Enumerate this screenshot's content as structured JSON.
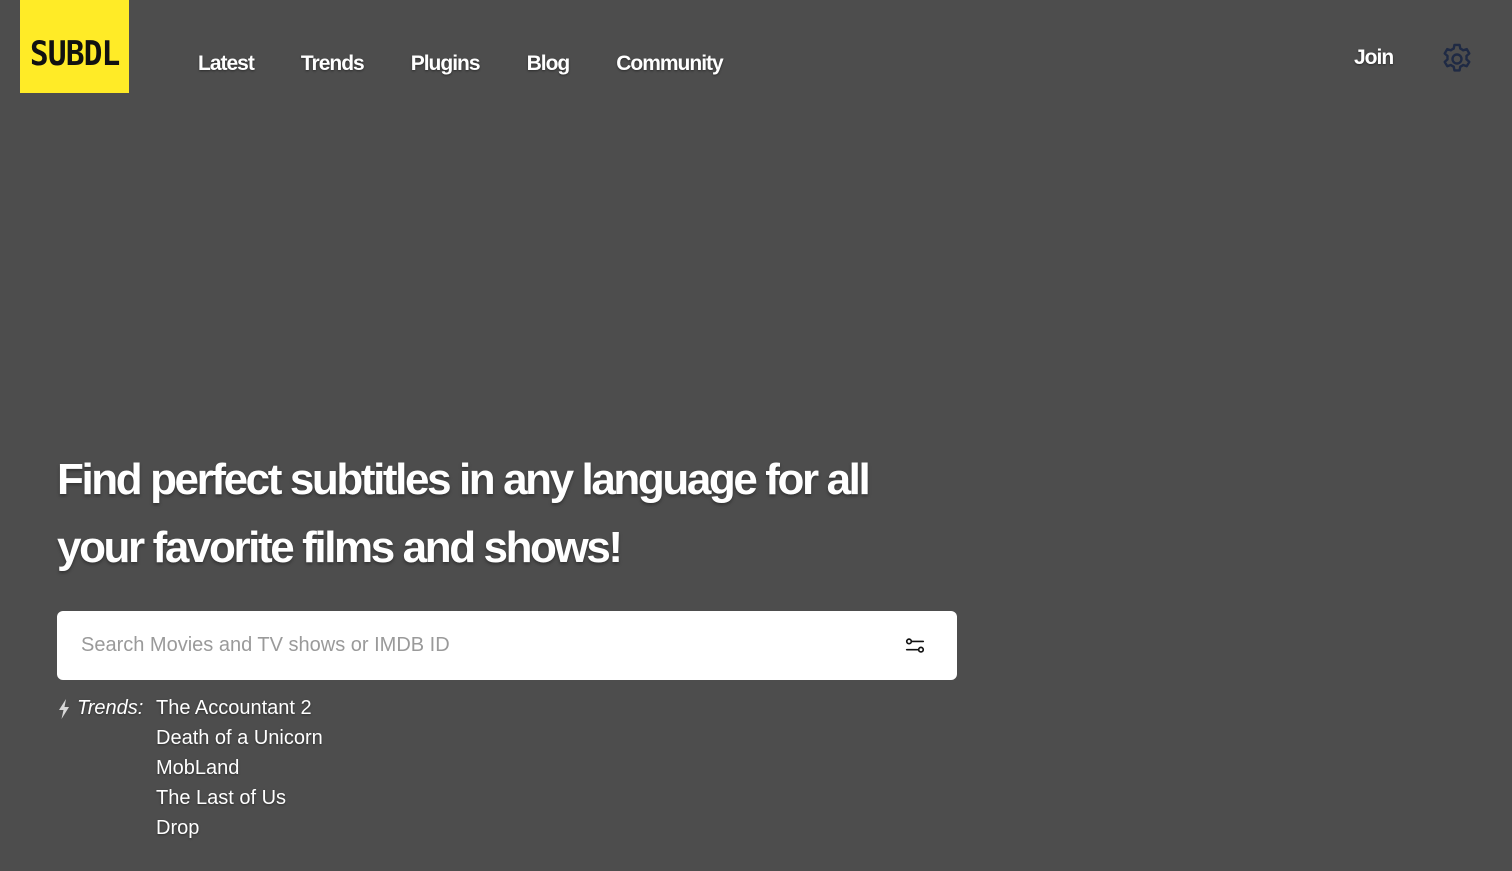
{
  "logo": {
    "text": "SUBDL",
    "bg_color": "#ffeb27"
  },
  "nav": {
    "items": [
      {
        "label": "Latest"
      },
      {
        "label": "Trends"
      },
      {
        "label": "Plugins"
      },
      {
        "label": "Blog"
      },
      {
        "label": "Community"
      }
    ]
  },
  "header": {
    "join_label": "Join",
    "settings_icon": "gear-icon"
  },
  "hero": {
    "headline": "Find perfect subtitles in any language for all your favorite films and shows!"
  },
  "search": {
    "placeholder": "Search Movies and TV shows or IMDB ID",
    "value": "",
    "filter_icon": "filter-sliders-icon"
  },
  "trends": {
    "label": "Trends:",
    "icon": "bolt-icon",
    "items": [
      "The Accountant 2",
      "Death of a Unicorn",
      "MobLand",
      "The Last of Us",
      "Drop"
    ]
  },
  "colors": {
    "background": "#4d4d4d",
    "accent": "#ffeb27",
    "gear": "#1f2a44"
  }
}
